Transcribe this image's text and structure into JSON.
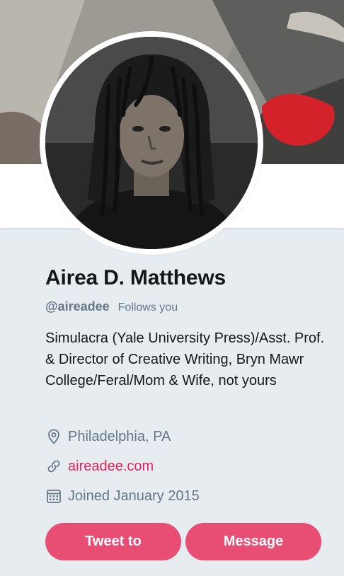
{
  "profile": {
    "name": "Airea D. Matthews",
    "handle": "@aireadee",
    "follows_you": "Follows you",
    "bio": "Simulacra (Yale University Press)/Asst. Prof. & Director of Creative Writing, Bryn Mawr College/Feral/Mom & Wife, not yours",
    "location": "Philadelphia, PA",
    "website": "aireadee.com",
    "joined": "Joined January 2015"
  },
  "actions": {
    "tweet_to": "Tweet to",
    "message": "Message"
  },
  "icons": {
    "location": "map-pin-icon",
    "website": "link-icon",
    "joined": "calendar-icon"
  },
  "colors": {
    "accent": "#e0245e",
    "button": "#e84d74",
    "muted": "#657786",
    "background": "#e6ecf0"
  }
}
